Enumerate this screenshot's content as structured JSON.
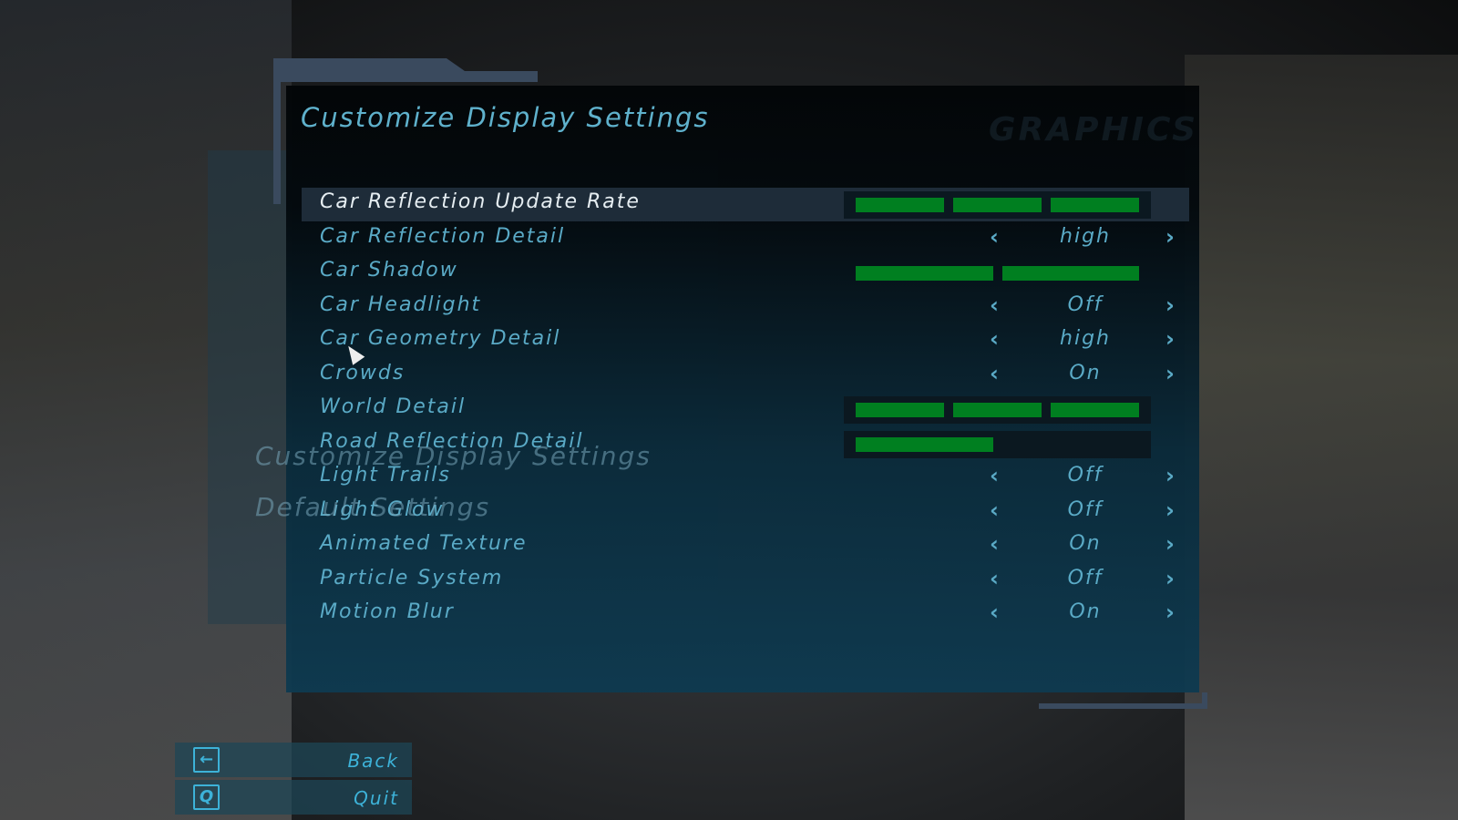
{
  "title": "Customize Display Settings",
  "watermark": "GRAPHICS",
  "background_menu": [
    "Customize Display Settings",
    "Default Settings"
  ],
  "accent_color": "#5aaac6",
  "bar_color": "#007f20",
  "settings": [
    {
      "label": "Car Reflection Update Rate",
      "type": "bar",
      "level": 3,
      "max": 3,
      "selected": true
    },
    {
      "label": "Car Reflection Detail",
      "type": "choice",
      "value": "high"
    },
    {
      "label": "Car Shadow",
      "type": "bar",
      "level": 2,
      "max": 2
    },
    {
      "label": "Car Headlight",
      "type": "choice",
      "value": "Off"
    },
    {
      "label": "Car Geometry Detail",
      "type": "choice",
      "value": "high"
    },
    {
      "label": "Crowds",
      "type": "choice",
      "value": "On"
    },
    {
      "label": "World Detail",
      "type": "bar",
      "level": 3,
      "max": 3
    },
    {
      "label": "Road Reflection Detail",
      "type": "bar",
      "level": 1,
      "max": 2
    },
    {
      "label": "Light Trails",
      "type": "choice",
      "value": "Off"
    },
    {
      "label": "Light Glow",
      "type": "choice",
      "value": "Off"
    },
    {
      "label": "Animated Texture",
      "type": "choice",
      "value": "On"
    },
    {
      "label": "Particle System",
      "type": "choice",
      "value": "Off"
    },
    {
      "label": "Motion Blur",
      "type": "choice",
      "value": "On"
    }
  ],
  "buttons": [
    {
      "key": "←",
      "label": "Back",
      "icon": "back-arrow-icon"
    },
    {
      "key": "Q",
      "label": "Quit",
      "icon": "q-key-icon"
    }
  ],
  "arrows": {
    "left": "‹",
    "right": "›"
  }
}
